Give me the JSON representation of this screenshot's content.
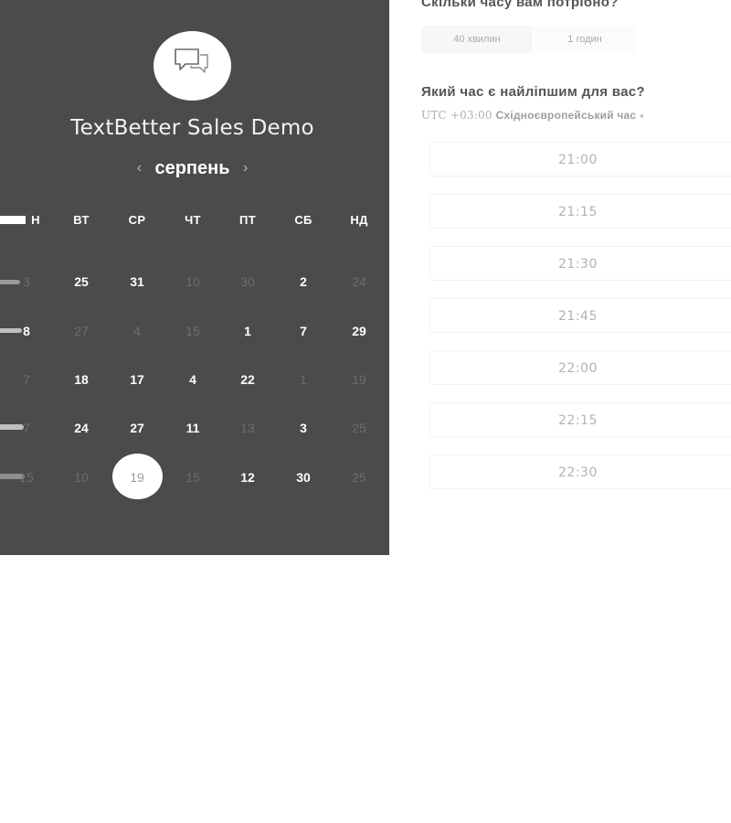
{
  "calendar": {
    "title": "TextBetter Sales Demo",
    "month": "серпень",
    "prev_arrow": "‹",
    "next_arrow": "›",
    "weekdays": [
      "Н",
      "ВТ",
      "СР",
      "ЧТ",
      "ПТ",
      "СБ",
      "НД"
    ],
    "rows": [
      [
        "3",
        "25",
        "31",
        "10",
        "30",
        "2",
        "24"
      ],
      [
        "8",
        "27",
        "4",
        "15",
        "1",
        "7",
        "29"
      ],
      [
        "7",
        "18",
        "17",
        "4",
        "22",
        "1",
        "19"
      ],
      [
        "7",
        "24",
        "27",
        "11",
        "13",
        "3",
        "25"
      ],
      [
        "15",
        "10",
        "19",
        "15",
        "12",
        "30",
        "25"
      ]
    ],
    "selected_day": "19"
  },
  "booking": {
    "duration_question": "Скільки часу вам потрібно?",
    "durations": [
      "40 хвилин",
      "1 годин"
    ],
    "time_question": "Який час є найліпшим для вас?",
    "timezone_offset": "UTC +03:00",
    "timezone_name": "Східноєвропейський час",
    "timezone_caret": "▾",
    "slots": [
      "21:00",
      "21:15",
      "21:30",
      "21:45",
      "22:00",
      "22:15",
      "22:30"
    ]
  },
  "colors": {
    "panel_bg": "#4b4b4b",
    "text_light": "#ffffff",
    "text_muted": "#6d6d6d",
    "slot_text": "#b3b3b3"
  },
  "icons": {
    "logo": "chat-bubbles-icon",
    "prev": "chevron-left-icon",
    "next": "chevron-right-icon",
    "timezone": "caret-down-icon"
  }
}
